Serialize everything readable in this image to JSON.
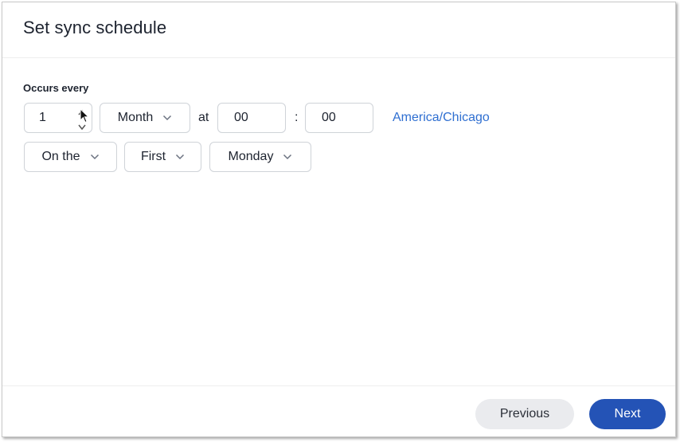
{
  "dialog": {
    "title": "Set sync schedule"
  },
  "schedule": {
    "section_label": "Occurs every",
    "interval_value": "1",
    "interval_unit": "Month",
    "at_label": "at",
    "hour": "00",
    "time_separator": ":",
    "minute": "00",
    "timezone": "America/Chicago",
    "day_mode": "On the",
    "ordinal": "First",
    "weekday": "Monday"
  },
  "icons": {
    "spin_up": "▲",
    "spin_down": "▼"
  },
  "footer": {
    "previous_label": "Previous",
    "next_label": "Next"
  },
  "colors": {
    "accent": "#2453b6",
    "link": "#2f6fd1",
    "secondary_button": "#eaebee"
  }
}
